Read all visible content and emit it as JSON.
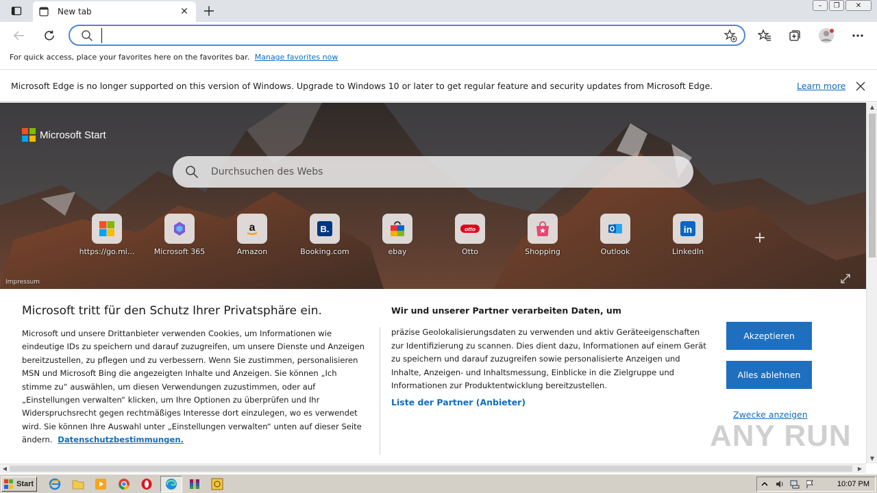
{
  "tab": {
    "title": "New tab"
  },
  "addressbar": {
    "value": "",
    "placeholder": ""
  },
  "favorites_bar": {
    "text": "For quick access, place your favorites here on the favorites bar.",
    "link": "Manage favorites now"
  },
  "notice": {
    "text": "Microsoft Edge is no longer supported on this version of Windows. Upgrade to Windows 10 or later to get regular feature and security updates from Microsoft Edge.",
    "link": "Learn more"
  },
  "hero": {
    "brand": "Microsoft Start",
    "search_placeholder": "Durchsuchen des Webs",
    "impressum": "Impressum",
    "tiles": [
      {
        "label": "https://go.mi...",
        "icon": "windows-icon"
      },
      {
        "label": "Microsoft 365",
        "icon": "microsoft-365-icon"
      },
      {
        "label": "Amazon",
        "icon": "amazon-icon"
      },
      {
        "label": "Booking.com",
        "icon": "booking-icon"
      },
      {
        "label": "ebay",
        "icon": "ebay-icon"
      },
      {
        "label": "Otto",
        "icon": "otto-icon"
      },
      {
        "label": "Shopping",
        "icon": "shopping-icon"
      },
      {
        "label": "Outlook",
        "icon": "outlook-icon"
      },
      {
        "label": "LinkedIn",
        "icon": "linkedin-icon"
      }
    ]
  },
  "consent": {
    "title": "Microsoft tritt für den Schutz Ihrer Privatsphäre ein.",
    "body": "Microsoft und unsere Drittanbieter verwenden Cookies, um Informationen wie eindeutige IDs zu speichern und darauf zuzugreifen, um unsere Dienste und Anzeigen bereitzustellen, zu pflegen und zu verbessern. Wenn Sie zustimmen, personalisieren MSN und Microsoft Bing die angezeigten Inhalte und Anzeigen. Sie können „Ich stimme zu“ auswählen, um diesen Verwendungen zuzustimmen, oder auf „Einstellungen verwalten“ klicken, um Ihre Optionen zu überprüfen und Ihr Widerspruchsrecht gegen rechtmäßiges Interesse dort einzulegen, wo es verwendet wird.  Sie können Ihre Auswahl unter „Einstellungen verwalten“ unten auf dieser Seite ändern.",
    "privacy_link": "Datenschutzbestimmungen.",
    "partners_title": "Wir und unserer Partner verarbeiten Daten, um",
    "partners_body": "präzise Geolokalisierungsdaten zu verwenden und aktiv Geräteeigenschaften zur Identifizierung zu scannen. Dies dient dazu, Informationen auf einem Gerät zu speichern und darauf zuzugreifen sowie personalisierte Anzeigen und Inhalte, Anzeigen- und Inhaltsmessung, Einblicke in die Zielgruppe und Informationen zur Produktentwicklung bereitzustellen.",
    "partners_link": "Liste der Partner (Anbieter)",
    "accept": "Akzeptieren",
    "reject": "Alles ablehnen",
    "purposes": "Zwecke anzeigen"
  },
  "watermark": "ANY RUN",
  "taskbar": {
    "start": "Start",
    "time": "10:07 PM"
  },
  "colors": {
    "accent": "#1f6fc0",
    "link": "#0f6cbd",
    "address_border": "#4a86d8"
  }
}
